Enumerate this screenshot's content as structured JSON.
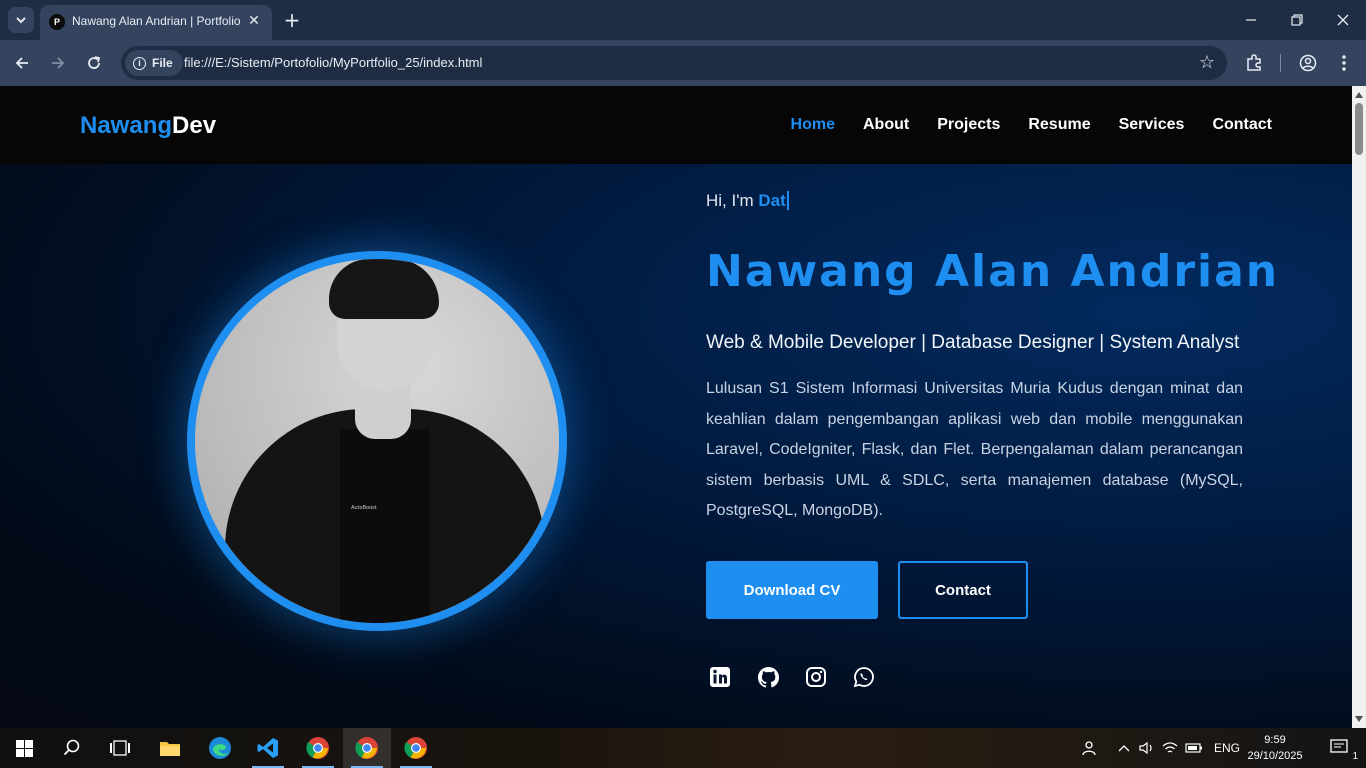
{
  "browser": {
    "tab_title": "Nawang Alan Andrian | Portfolio",
    "tab_favicon_letter": "P",
    "site_chip_label": "File",
    "url": "file:///E:/Sistem/Portofolio/MyPortfolio_25/index.html"
  },
  "site": {
    "logo_part1": "Nawang",
    "logo_part2": "Dev",
    "nav": [
      "Home",
      "About",
      "Projects",
      "Resume",
      "Services",
      "Contact"
    ],
    "active_nav": "Home",
    "greeting_prefix": "Hi, I'm ",
    "greeting_typed": "Dat",
    "name": "Nawang Alan Andrian",
    "roles": "Web & Mobile Developer | Database Designer | System Analyst",
    "description": "Lulusan S1 Sistem Informasi Universitas Muria Kudus dengan minat dan keahlian dalam pengembangan aplikasi web dan mobile menggunakan Laravel, CodeIgniter, Flask, dan Flet. Berpengalaman dalam perancangan sistem berbasis UML & SDLC, serta manajemen database (MySQL, PostgreSQL, MongoDB).",
    "btn_download": "Download CV",
    "btn_contact": "Contact",
    "shirt_text": "AutoBoost"
  },
  "social_icons": [
    "linkedin-icon",
    "github-icon",
    "instagram-icon",
    "whatsapp-icon"
  ],
  "taskbar": {
    "language": "ENG",
    "time": "9:59",
    "date": "29/10/2025",
    "notification_count": "1"
  },
  "colors": {
    "accent": "#1e8ef0",
    "nav_bg": "#060606",
    "chrome_bg": "#1f2d44",
    "toolbar_bg": "#34445e"
  }
}
